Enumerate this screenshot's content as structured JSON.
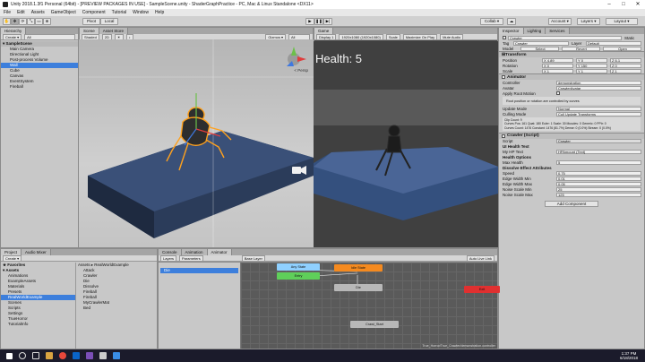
{
  "window": {
    "title": "Unity 2018.1.3f1 Personal (64bit) - [PREVIEW PACKAGES IN USE] - SampleScene.unity - ShaderGraphPractice - PC, Mac & Linux Standalone <DX11>",
    "controls": [
      "–",
      "□",
      "✕"
    ]
  },
  "menu": [
    "File",
    "Edit",
    "Assets",
    "GameObject",
    "Component",
    "Tutorial",
    "Window",
    "Help"
  ],
  "toolbar": {
    "pivot": "Pivot",
    "local": "Local",
    "collab": "Collab ▾",
    "account": "Account ▾",
    "layers": "Layers ▾",
    "layout": "Layout ▾",
    "colors": {
      "play_bg": "#e4e4e4"
    }
  },
  "hierarchy": {
    "tab": "Hierarchy",
    "create": "Create ▾",
    "search": "All",
    "scene": "SampleScene",
    "items": [
      "Main Camera",
      "Directional Light",
      "Post-process Volume",
      "Wall",
      "Cube",
      "Canvas",
      "EventSystem",
      "Fireball"
    ],
    "selected_index": 3
  },
  "scene": {
    "tabs": [
      "Scene",
      "Asset Store"
    ],
    "shaded": "Shaded",
    "mode2d": "2D",
    "gizmos": "Gizmos ▾",
    "search": "All",
    "persp": "< Persp"
  },
  "game": {
    "tab": "Game",
    "display": "Display 1",
    "resolution": "1920x1080 (1920x1080)",
    "scale": "Scale",
    "maximize": "Maximize On Play",
    "mute": "Mute Audio",
    "stats": "Stats",
    "gizmos": "Gizmos",
    "health": "Health: 5"
  },
  "inspector": {
    "tabs": [
      "Inspector",
      "Lighting",
      "Services"
    ],
    "name": "Crawler",
    "static": "Static",
    "tag_label": "Tag",
    "tag": "Crawler",
    "layer_label": "Layer",
    "layer": "Default",
    "prefab_label": "Model",
    "prefab_select": "Select",
    "prefab_revert": "Revert",
    "prefab_open": "Open",
    "transform": {
      "title": "Transform",
      "rows": [
        {
          "k": "Position",
          "x": "X 4.89",
          "y": "Y 0",
          "z": "Z 6.1"
        },
        {
          "k": "Rotation",
          "x": "X 0",
          "y": "Y 150",
          "z": "Z 0"
        },
        {
          "k": "Scale",
          "x": "X 1",
          "y": "Y 1",
          "z": "Z 1"
        }
      ]
    },
    "animator": {
      "title": "Animator",
      "controller_k": "Controller",
      "controller": "demonstration",
      "avatar_k": "Avatar",
      "avatar": "CrawlerAvatar",
      "root_k": "Apply Root Motion",
      "note": "Root position or rotation are controlled by curves",
      "update_k": "Update Mode",
      "update": "Normal",
      "cull_k": "Culling Mode",
      "cull": "Cull Update Transforms",
      "info": [
        "Clip Count: 9",
        "Curves Pos: 161 Quat: 180 Euler: 1 Scale: 30 Muscles: 0 Generic: 0 PPtr: 0",
        "Curves Count: 1476 Constant: 1476 (81.7%) Dense: 0 (0.0%) Stream: 0 (0.0%)"
      ]
    },
    "crawler": {
      "title": "Crawler (Script)",
      "script_k": "Script",
      "script": "Crawler",
      "ui_text": "UI Health Text",
      "hp_k": "My HP Text",
      "hp": "HPAmount (Text)",
      "health_options": "Health Options",
      "max_k": "Max Health",
      "max": "5",
      "dissolve": "Dissolve Effect Attributes",
      "attrs": [
        {
          "k": "Speed",
          "v": "0.75"
        },
        {
          "k": "Edge Width Min",
          "v": "0.01"
        },
        {
          "k": "Edge Width Max",
          "v": "0.05"
        },
        {
          "k": "Noise Scale Min",
          "v": "25"
        },
        {
          "k": "Noise Scale Max",
          "v": "125"
        }
      ]
    },
    "add_component": "Add Component"
  },
  "project": {
    "tabs": [
      "Project",
      "Audio Mixer"
    ],
    "create": "Create ▾",
    "favorites": "Favorites",
    "assets": "Assets",
    "tree": [
      "Animations",
      "ExampleAssets",
      "Materials",
      "Presets",
      "RealWorldExample",
      "Scenes",
      "Scripts",
      "Settings",
      "TrueHorror",
      "TutorialInfo"
    ],
    "breadcrumb": "Assets ▸ RealWorldExample",
    "files": [
      "Attack",
      "Crawler",
      "Die",
      "Dissolve",
      "Fireball",
      "Fireball",
      "MyCrawlerMat",
      "Bed"
    ]
  },
  "animator_panel": {
    "tabs": [
      "Console",
      "Animation",
      "Animator"
    ],
    "subtabs": [
      "Layers",
      "Parameters"
    ],
    "layer": "Base Layer",
    "auto_live": "Auto Live Link",
    "param_name": "Die",
    "path": "True_Horror/True_Crawler/demonstration.controller",
    "nodes": [
      "Any State",
      "Idle State",
      "Entry",
      "Die",
      "Exit",
      "Crawl_Start"
    ]
  },
  "clock": {
    "time": "1:37 PM",
    "date": "6/18/2018"
  }
}
